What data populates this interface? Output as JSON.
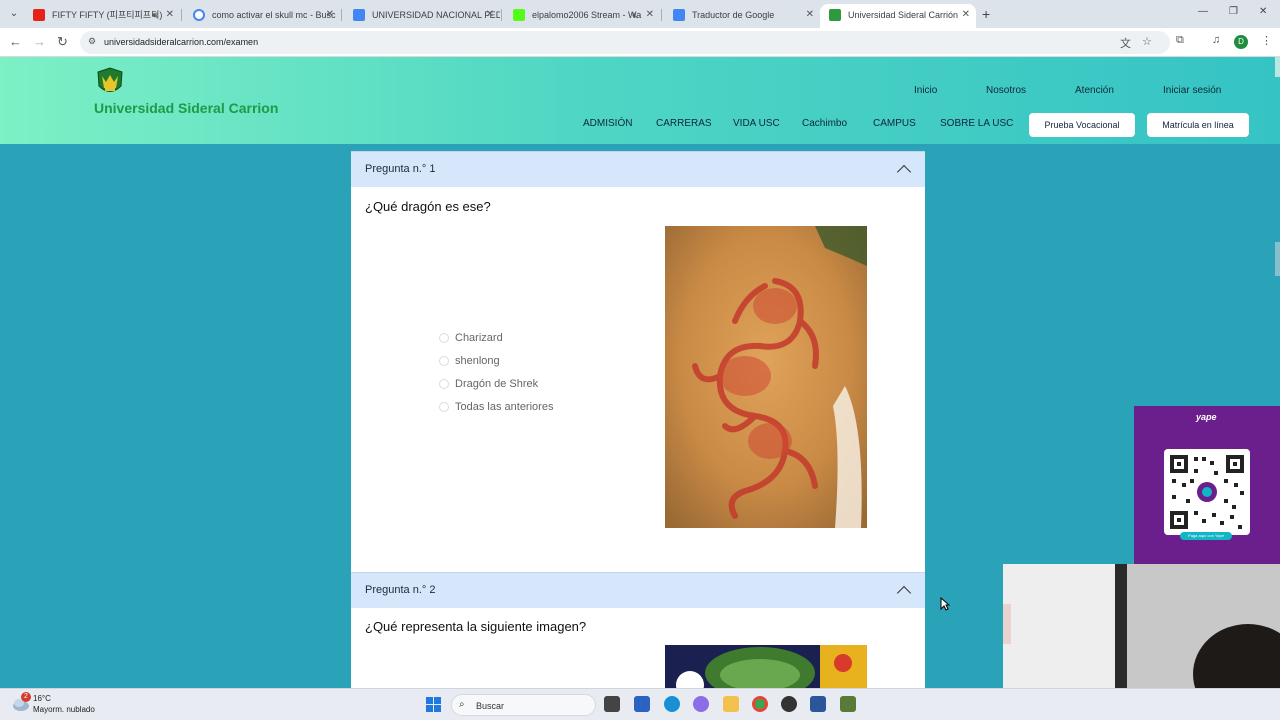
{
  "browser": {
    "tabs": [
      {
        "title": "FIFTY FIFTY (피프티피프티)",
        "favicon_color": "#e62117",
        "muted_icon": "speaker-icon"
      },
      {
        "title": "como activar el skull mc - Busc",
        "favicon_color": "#4285f4"
      },
      {
        "title": "UNIVERSIDAD NACIONAL FED",
        "favicon_color": "#4285f4"
      },
      {
        "title": "elpalomo2006 Stream - Wa",
        "favicon_color": "#53fc18",
        "muted_icon": "speaker-muted-icon"
      },
      {
        "title": "Traductor de Google",
        "favicon_color": "#4285f4"
      },
      {
        "title": "Universidad Sideral Carrión",
        "favicon_color": "#2e9a3e",
        "active": true
      }
    ],
    "url": "universidadsideralcarrion.com/examen",
    "profile_initial": "D"
  },
  "site": {
    "brand": "Universidad Sideral Carrion",
    "brand_color": "#1f9a47",
    "top_nav": [
      "Inicio",
      "Nosotros",
      "Atención",
      "Iniciar sesión"
    ],
    "main_nav": [
      "ADMISIÓN",
      "CARRERAS",
      "VIDA USC",
      "Cachimbo",
      "CAMPUS",
      "SOBRE LA USC"
    ],
    "buttons": {
      "vocacional": "Prueba Vocacional",
      "matricula": "Matrícula en línea"
    }
  },
  "exam": {
    "questions": [
      {
        "header": "Pregunta n.° 1",
        "text": "¿Qué dragón es ese?",
        "options": [
          "Charizard",
          "shenlong",
          "Dragón de Shrek",
          "Todas las anteriores"
        ]
      },
      {
        "header": "Pregunta n.° 2",
        "text": "¿Qué representa la siguiente imagen?"
      }
    ]
  },
  "ad": {
    "brand": "yape",
    "caption": "Paga aquí con Yape",
    "accent": "#6a1f8c"
  },
  "taskbar": {
    "notification_count": "2",
    "temperature": "16°C",
    "weather": "Mayorm. nublado",
    "search_placeholder": "Buscar"
  }
}
